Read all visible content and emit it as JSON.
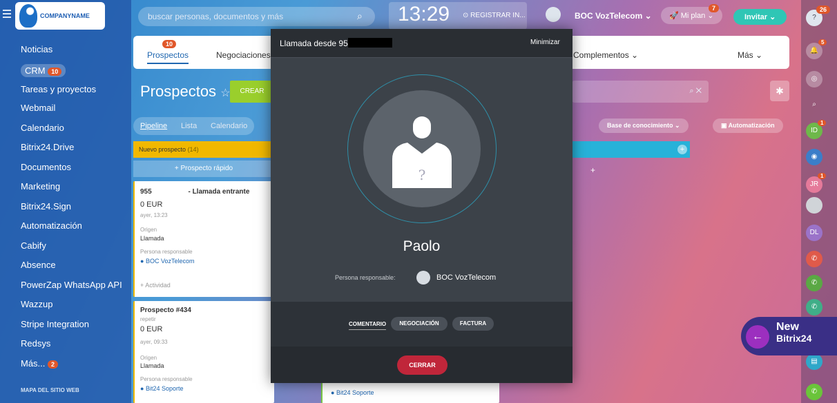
{
  "logo": {
    "text": "COMPANYNAME"
  },
  "sidebar": {
    "items": [
      {
        "label": "Noticias"
      },
      {
        "label": "CRM",
        "badge": "10"
      },
      {
        "label": "Tareas y proyectos"
      },
      {
        "label": "Webmail"
      },
      {
        "label": "Calendario"
      },
      {
        "label": "Bitrix24.Drive"
      },
      {
        "label": "Documentos"
      },
      {
        "label": "Marketing"
      },
      {
        "label": "Bitrix24.Sign"
      },
      {
        "label": "Automatización"
      },
      {
        "label": "Cabify"
      },
      {
        "label": "Absence"
      },
      {
        "label": "PowerZap WhatsApp API"
      },
      {
        "label": "Wazzup"
      },
      {
        "label": "Stripe Integration"
      },
      {
        "label": "Redsys"
      },
      {
        "label": "Más...",
        "badge": "2"
      }
    ],
    "footer": "MAPA DEL SITIO WEB"
  },
  "header": {
    "search_placeholder": "buscar personas, documentos y más",
    "clock": "13:29",
    "register": "REGISTRAR IN...",
    "user": "BOC VozTelecom",
    "plan": "Mi plan",
    "plan_badge": "7",
    "invite": "Invitar",
    "help_badge": "26"
  },
  "crm_tabs": {
    "prospectos": "Prospectos",
    "prospectos_badge": "10",
    "negociaciones": "Negociaciones",
    "complementos": "Complementos",
    "mas": "Más"
  },
  "page": {
    "title": "Prospectos",
    "create": "CREAR",
    "views": [
      "Pipeline",
      "Lista",
      "Calendario"
    ],
    "knowledge": "Base de conocimiento",
    "automation": "Automatización"
  },
  "kanban": {
    "column": "Nuevo prospecto",
    "count": "(14)",
    "quick": "+ Prospecto rápido",
    "card1": {
      "title_prefix": "955",
      "title_suffix": "- Llamada entrante",
      "amount": "0 EUR",
      "date": "ayer, 13:23",
      "origin_label": "Origen",
      "origin": "Llamada",
      "resp_label": "Persona responsable",
      "resp": "BOC VozTelecom",
      "activity": "+ Actividad"
    },
    "card2": {
      "title": "Prospecto #434",
      "sub": "repetir",
      "amount": "0 EUR",
      "date": "ayer, 09:33",
      "origin_label": "Origen",
      "origin": "Llamada",
      "resp_label": "Persona responsable",
      "resp": "Bit24 Soporte"
    },
    "card3_resp": "Bit24 Soporte"
  },
  "call": {
    "title": "Llamada desde 95",
    "minimize": "Minimizar",
    "name": "Paolo",
    "resp_label": "Persona responsable:",
    "resp": "BOC VozTelecom",
    "tabs": [
      "COMENTARIO",
      "NEGOCIACIÓN",
      "FACTURA"
    ],
    "close": "CERRAR"
  },
  "right_rail": {
    "notify_badge": "5",
    "id": "ID",
    "id_badge": "1",
    "jr": "JR",
    "jr_badge": "1",
    "dl": "DL"
  },
  "promo": {
    "line1": "New",
    "line2": "Bitrix24"
  }
}
